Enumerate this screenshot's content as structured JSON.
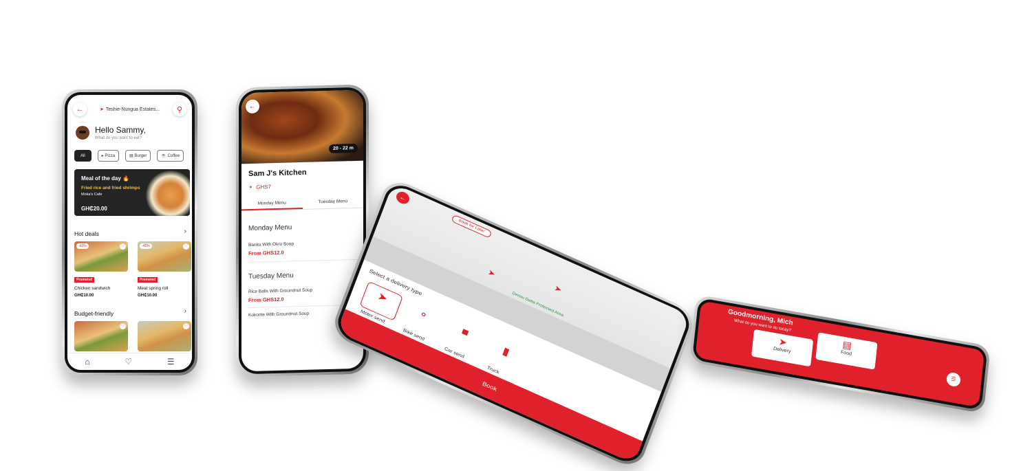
{
  "home": {
    "location": "Teshie-Nungua Estates...",
    "greeting": "Hello Sammy,",
    "subtitle": "What do you want to eat?",
    "chips": [
      "All",
      "Pizza",
      "Burger",
      "Coffee"
    ],
    "meal_banner": {
      "title": "Meal of the day 🔥",
      "dish": "Fried rice and fried shrimps",
      "cafe": "Moka's Cafe",
      "price": "GH₵20.00"
    },
    "hot_deals_title": "Hot deals",
    "hot_deals": [
      {
        "discount": "-60%",
        "badge": "Promoted",
        "name": "Chicken sandwich",
        "price": "GH₵10.00"
      },
      {
        "discount": "-45%",
        "badge": "Promoted",
        "name": "Meat spring roll",
        "price": "GH₵10.00"
      }
    ],
    "budget_title": "Budget-friendly"
  },
  "kitchen": {
    "time": "20 - 22 m",
    "name": "Sam J's Kitchen",
    "fee": "GHS7",
    "tabs": [
      "Monday Menu",
      "Tuesday Menu"
    ],
    "monday_heading": "Monday Menu",
    "monday_items": [
      {
        "name": "Banku With Okro Soup",
        "price": "From GHS12.0"
      }
    ],
    "tuesday_heading": "Tuesday Menu",
    "tuesday_items": [
      {
        "name": "Rice Balls With Groundnut Soup",
        "price": "From GHS12.0"
      },
      {
        "name": "Kokonte With Groundnut Soup",
        "price": ""
      }
    ]
  },
  "delivery": {
    "book_pill": "Book for Later",
    "map_label": "Densu Delta Protected Area",
    "select_label": "Select a delivery type",
    "types": [
      "Motor send",
      "Bike send",
      "Car send",
      "Truck"
    ],
    "book_button": "Book"
  },
  "services": {
    "greeting": "Goodmorning, Mich",
    "subtitle": "What do you want to do today?",
    "options": [
      "Delivery",
      "Food"
    ]
  },
  "colors": {
    "accent": "#e0202a",
    "dark": "#242424"
  },
  "icons": [
    "back-arrow-icon",
    "location-pin-icon",
    "search-icon",
    "heart-icon",
    "home-icon",
    "list-icon",
    "chevron-right-icon",
    "bike-icon",
    "scooter-icon",
    "car-icon",
    "truck-icon"
  ]
}
